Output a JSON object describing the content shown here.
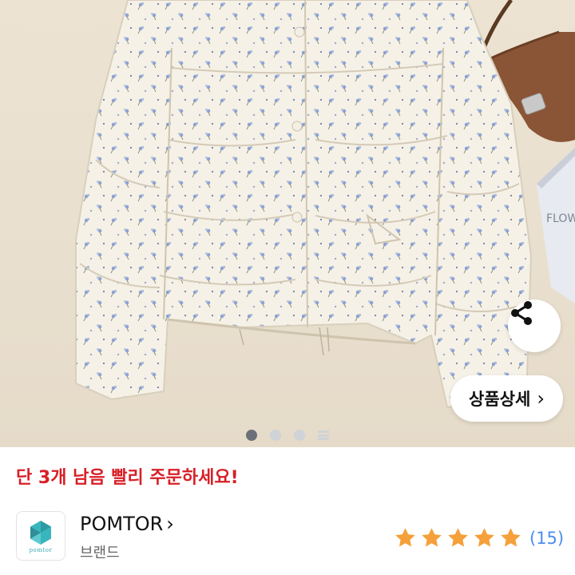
{
  "product": {
    "share_icon": "share-icon",
    "detail_button_label": "상품상세",
    "detail_button_icon": "chevron-right-icon",
    "image_count": 4,
    "active_image_index": 0
  },
  "stock_notice": {
    "text": "단 3개 남음 빨리 주문하세요!",
    "color": "#d71f26"
  },
  "brand": {
    "name": "POMTOR",
    "name_suffix": "›",
    "logo_text": "pomtor",
    "label": "브랜드"
  },
  "rating": {
    "stars": 5,
    "max_stars": 5,
    "review_count": "(15)",
    "star_color": "#f5a03a",
    "count_color": "#4a8ef0"
  },
  "background_book_text": "FLOW"
}
